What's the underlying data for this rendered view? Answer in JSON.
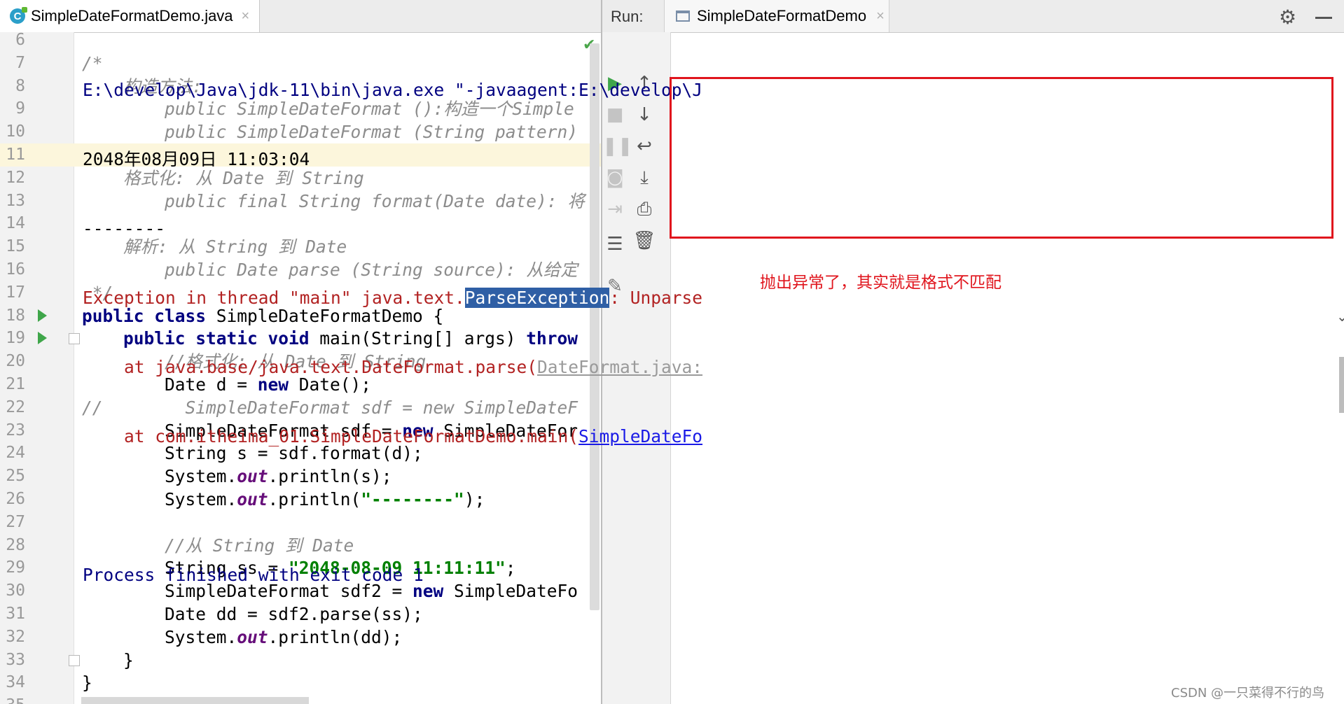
{
  "editor": {
    "tab_label": "SimpleDateFormatDemo.java",
    "tab_close": "×",
    "check_glyph": "✔"
  },
  "run": {
    "label": "Run:",
    "tab_label": "SimpleDateFormatDemo",
    "tab_close": "×"
  },
  "annotation": "抛出异常了，其实就是格式不匹配",
  "watermark": "CSDN @一只菜得不行的鸟"
}
